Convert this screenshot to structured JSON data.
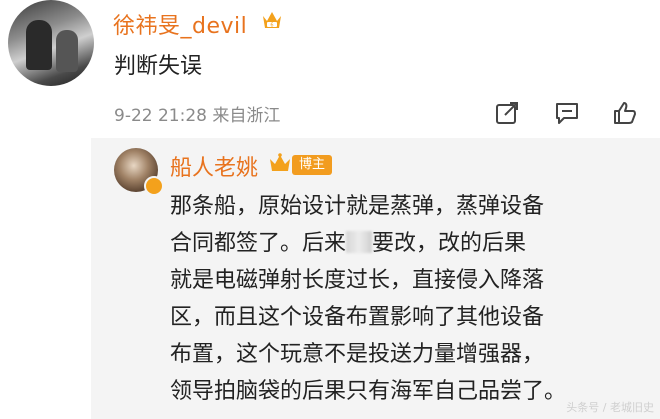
{
  "comment": {
    "username": "徐祎旻_devil",
    "badge_icon": "vip-badge-icon",
    "text": "判断失误",
    "meta": "9-22 21:28 来自浙江",
    "actions": [
      "share-icon",
      "comment-icon",
      "like-icon"
    ]
  },
  "reply": {
    "username": "船人老姚",
    "crown_icon": "crown-icon",
    "tag": "博主",
    "lines": [
      "那条船，原始设计就是蒸弹，蒸弹设备",
      "合同都签了。后来",
      "要改，改的后果",
      "就是电磁弹射长度过长，直接侵入降落",
      "区，而且这个设备布置影响了其他设备",
      "布置，这个玩意不是投送力量增强器，",
      "领导拍脑袋的后果只有海军自己品尝了。"
    ]
  },
  "watermark": "头条号 / 老城旧史",
  "colors": {
    "username": "#e8731e",
    "tag_bg": "#f29c1f",
    "meta": "#8a8a8a",
    "reply_bg": "#f4f4f4"
  }
}
